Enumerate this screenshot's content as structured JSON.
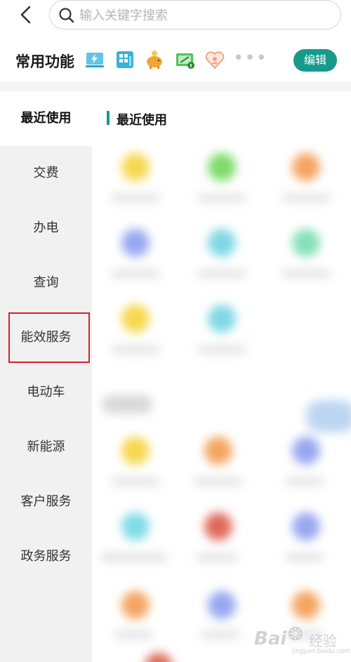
{
  "search": {
    "placeholder": "输入关键字搜索"
  },
  "common": {
    "title": "常用功能",
    "icons": [
      "flash-display-icon",
      "building-grid-icon",
      "piggy-bank-icon",
      "electric-meter-icon",
      "heart-person-icon"
    ],
    "more": "•••",
    "edit_label": "编辑"
  },
  "sidebar": {
    "items": [
      {
        "label": "最近使用",
        "active": true
      },
      {
        "label": "交费"
      },
      {
        "label": "办电"
      },
      {
        "label": "查询"
      },
      {
        "label": "能效服务",
        "highlighted": true
      },
      {
        "label": "电动车"
      },
      {
        "label": "新能源"
      },
      {
        "label": "客户服务"
      },
      {
        "label": "政务服务"
      }
    ]
  },
  "content": {
    "section_title": "最近使用"
  },
  "watermark": {
    "brand": "Bai",
    "brand2": "经验",
    "sub": "jingyan.baidu.com"
  },
  "colors": {
    "accent": "#179a8c",
    "highlight": "#d3222a"
  }
}
